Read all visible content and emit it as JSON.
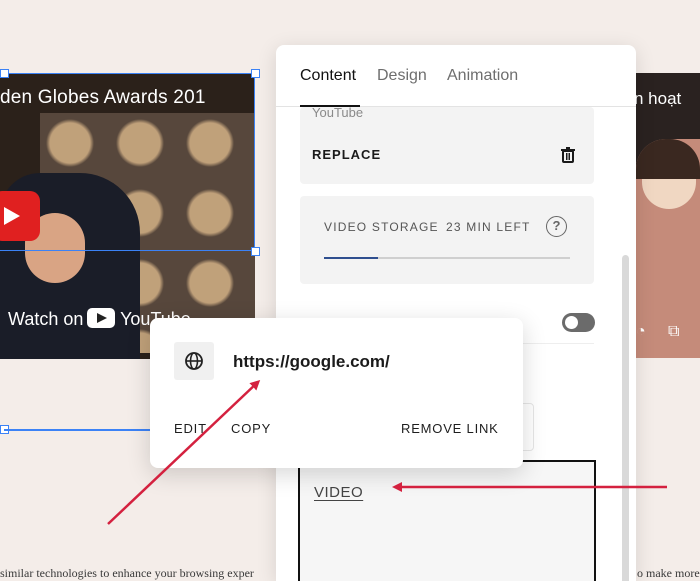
{
  "background": {
    "left_video": {
      "title": "den Globes Awards 201",
      "watch_label": "Watch on",
      "yt_wordmark": "YouTube"
    },
    "right_video": {
      "title": "n hoạt"
    },
    "footer_left": "similar technologies to enhance your browsing exper",
    "footer_right": "o make more"
  },
  "panel": {
    "tabs": [
      {
        "label": "Content",
        "active": true
      },
      {
        "label": "Design",
        "active": false
      },
      {
        "label": "Animation",
        "active": false
      }
    ],
    "source_label": "YouTube",
    "replace_label": "REPLACE",
    "storage": {
      "label": "VIDEO STORAGE",
      "remaining": "23 MIN LEFT",
      "help": "?",
      "fill_fraction": 0.22
    },
    "toggle_on": false,
    "preview_link": "VIDEO"
  },
  "popover": {
    "url": "https://google.com/",
    "edit_label": "EDIT",
    "copy_label": "COPY",
    "remove_label": "REMOVE LINK"
  },
  "colors": {
    "accent": "#3b82f6",
    "arrow": "#d4213f",
    "progress": "#2f4f8f"
  },
  "icons": [
    "globe-icon",
    "trash-icon",
    "help-icon",
    "play-icon"
  ]
}
